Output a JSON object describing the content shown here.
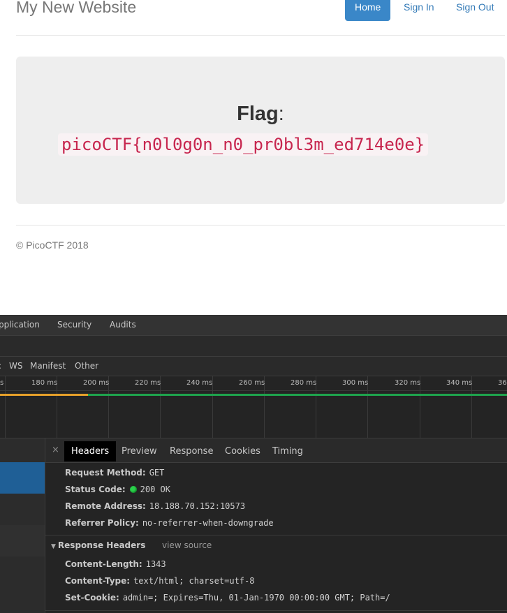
{
  "site": {
    "brand": "My New Website",
    "nav": {
      "home": "Home",
      "sign_in": "Sign In",
      "sign_out": "Sign Out"
    },
    "flag_label": "Flag",
    "flag_colon": ":",
    "flag_value": "picoCTF{n0l0g0n_n0_pr0bl3m_ed714e0e}",
    "footer": "© PicoCTF 2018"
  },
  "devtools": {
    "tabs": [
      "pplication",
      "Security",
      "Audits"
    ],
    "filters": [
      ":",
      "WS",
      "Manifest",
      "Other"
    ],
    "timeline_ticks": [
      "s",
      "180 ms",
      "200 ms",
      "220 ms",
      "240 ms",
      "260 ms",
      "280 ms",
      "300 ms",
      "320 ms",
      "340 ms",
      "36"
    ],
    "detail_tabs": {
      "close": "×",
      "headers": "Headers",
      "preview": "Preview",
      "response": "Response",
      "cookies": "Cookies",
      "timing": "Timing"
    },
    "general": {
      "request_method_key": "Request Method:",
      "request_method": "GET",
      "status_code_key": "Status Code:",
      "status_code": "200 OK",
      "remote_address_key": "Remote Address:",
      "remote_address": "18.188.70.152:10573",
      "referrer_policy_key": "Referrer Policy:",
      "referrer_policy": "no-referrer-when-downgrade"
    },
    "response_headers": {
      "title": "Response Headers",
      "view_source": "view source",
      "content_length_key": "Content-Length:",
      "content_length": "1343",
      "content_type_key": "Content-Type:",
      "content_type": "text/html; charset=utf-8",
      "set_cookie_key": "Set-Cookie:",
      "set_cookie": "admin=; Expires=Thu, 01-Jan-1970 00:00:00 GMT; Path=/"
    },
    "colors": {
      "status_ok": "#2bd14b",
      "selected_row": "#1f5f96",
      "waterfall_wait": "#e6a02a",
      "waterfall_download": "#1ea34d"
    }
  }
}
